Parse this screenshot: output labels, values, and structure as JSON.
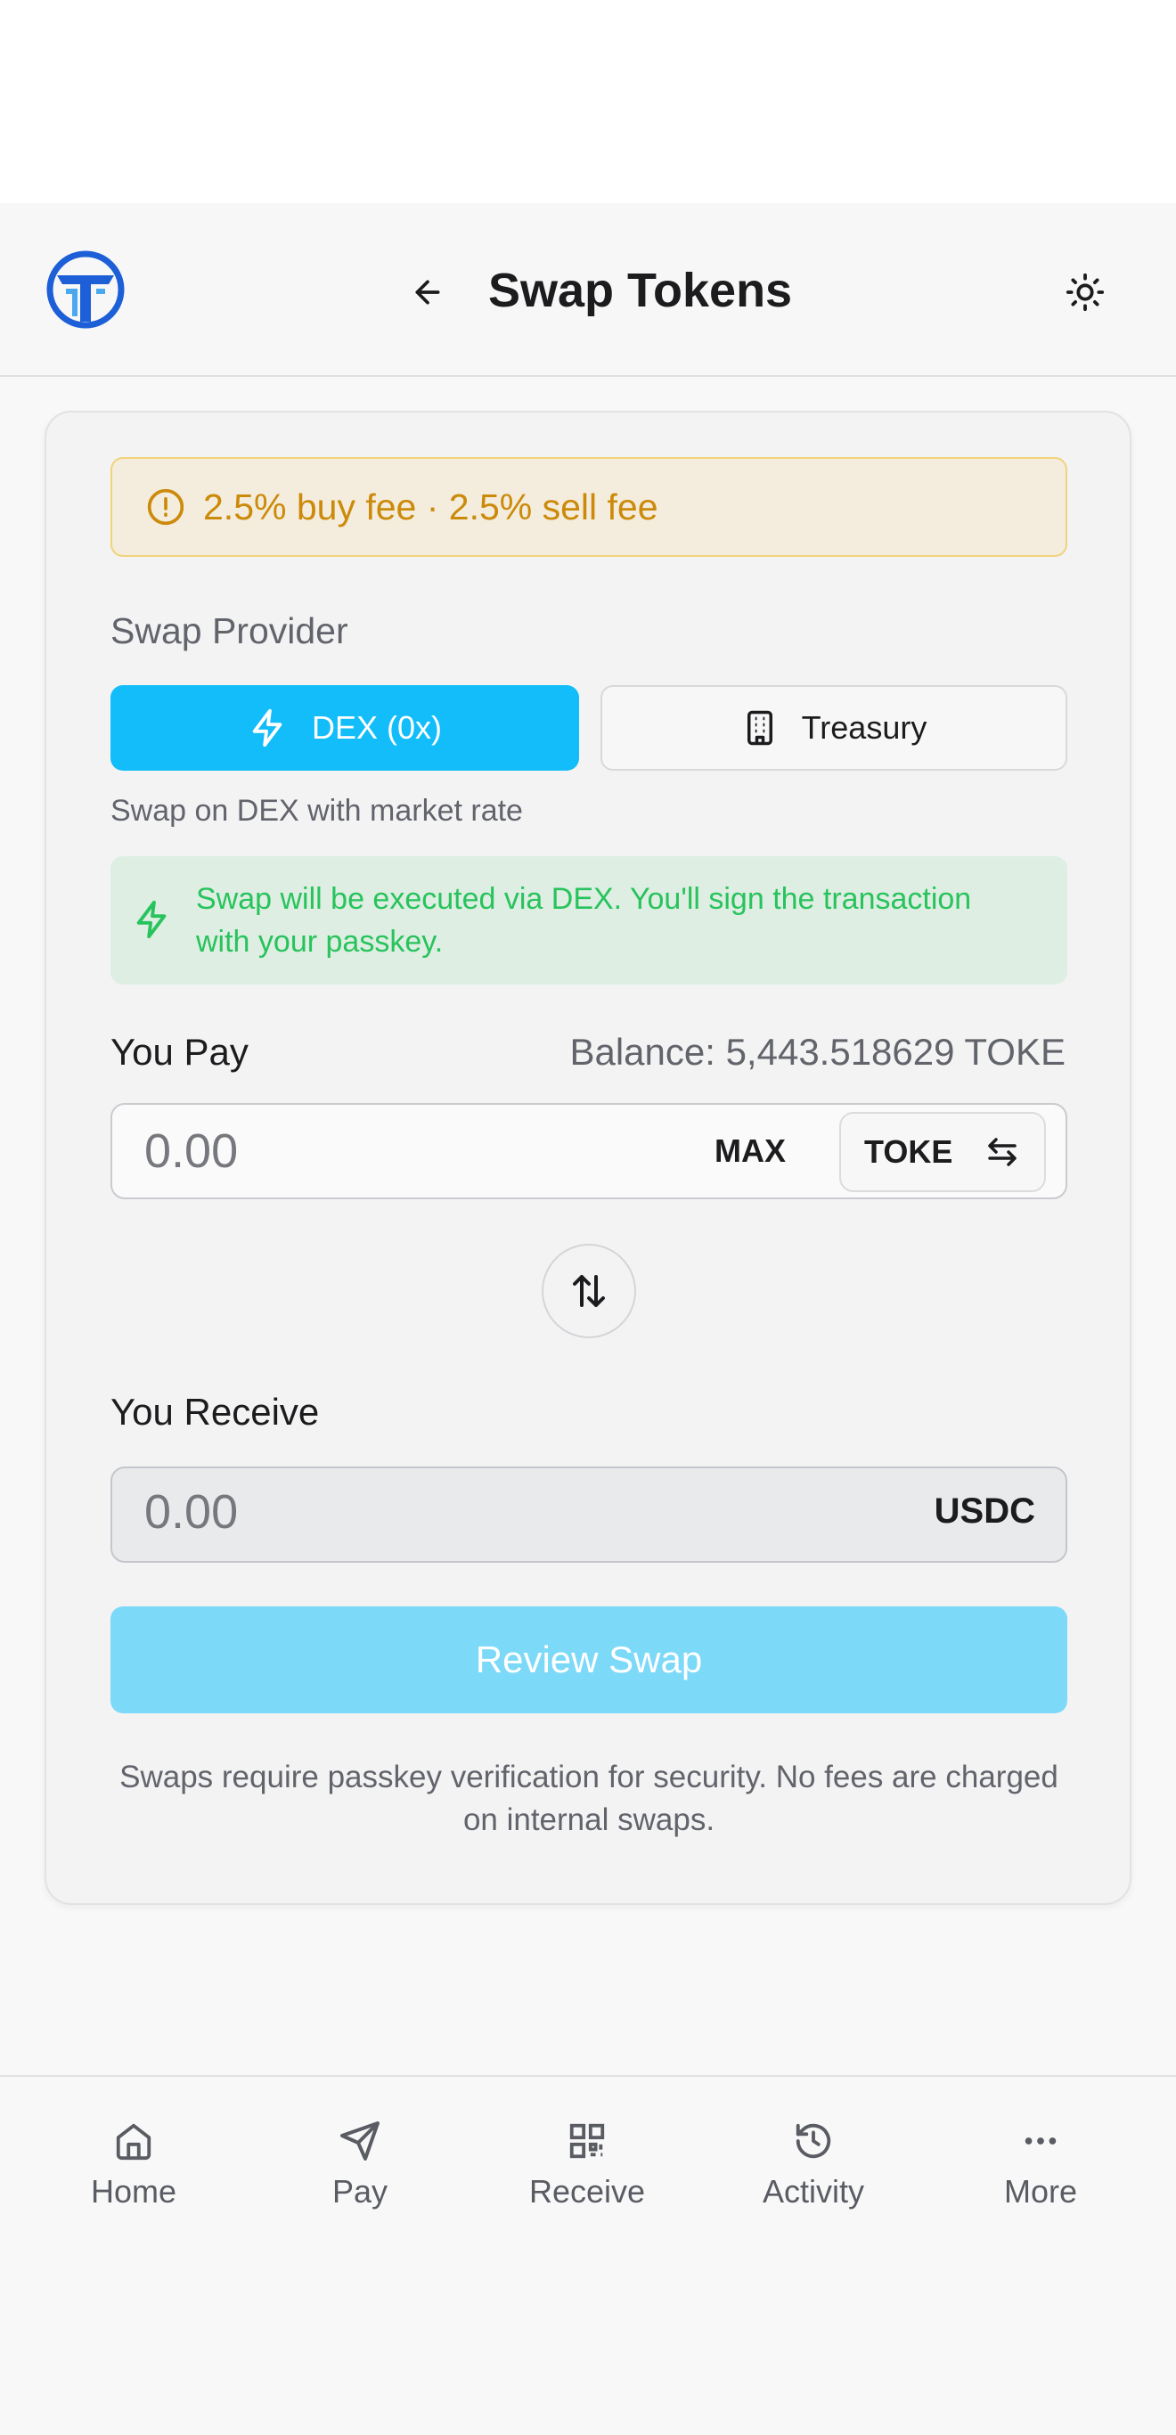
{
  "header": {
    "title": "Swap Tokens",
    "logo_icon": "tokena-logo-icon",
    "back_icon": "arrow-left-icon",
    "theme_icon": "sun-icon"
  },
  "colors": {
    "accent": "#13bdfa",
    "accent_disabled": "#7dd9f8",
    "warning": "#cc8a0a",
    "success": "#28c35c",
    "logo_blue": "#1d5fd6"
  },
  "fee_notice": {
    "icon": "alert-circle-icon",
    "text": "2.5% buy fee · 2.5% sell fee"
  },
  "provider": {
    "label": "Swap Provider",
    "options": [
      {
        "label": "DEX (0x)",
        "icon": "zap-icon",
        "selected": true
      },
      {
        "label": "Treasury",
        "icon": "building-icon",
        "selected": false
      }
    ],
    "description": "Swap on DEX with market rate",
    "info": {
      "icon": "zap-icon",
      "text": "Swap will be executed via DEX. You'll sign the transaction with your passkey."
    }
  },
  "pay": {
    "label": "You Pay",
    "balance": "Balance: 5,443.518629 TOKE",
    "placeholder": "0.00",
    "max_label": "MAX",
    "token": "TOKE",
    "token_icon": "arrows-left-right-icon"
  },
  "flip_icon": "arrows-up-down-icon",
  "receive": {
    "label": "You Receive",
    "value": "0.00",
    "token": "USDC"
  },
  "review_button": "Review Swap",
  "note": "Swaps require passkey verification for security. No fees are charged on internal swaps.",
  "nav": [
    {
      "label": "Home",
      "icon": "home-icon"
    },
    {
      "label": "Pay",
      "icon": "send-icon"
    },
    {
      "label": "Receive",
      "icon": "qr-code-icon"
    },
    {
      "label": "Activity",
      "icon": "history-icon"
    },
    {
      "label": "More",
      "icon": "more-horizontal-icon"
    }
  ]
}
